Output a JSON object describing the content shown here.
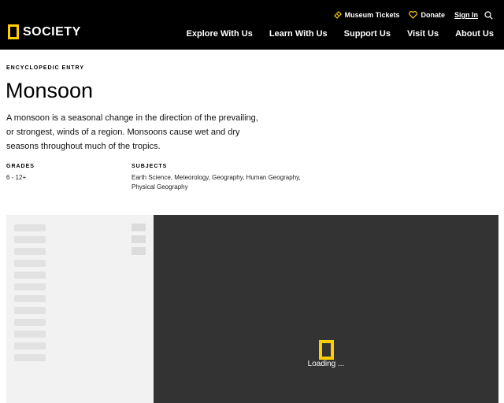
{
  "header": {
    "logo_text": "SOCIETY",
    "utility": {
      "museum_tickets": "Museum Tickets",
      "donate": "Donate",
      "sign_in": "Sign In"
    },
    "nav": [
      "Explore With Us",
      "Learn With Us",
      "Support Us",
      "Visit Us",
      "About Us"
    ]
  },
  "article": {
    "eyebrow": "ENCYCLOPEDIC ENTRY",
    "title": "Monsoon",
    "description": "A monsoon is a seasonal change in the direction of the prevailing, or strongest, winds of a region. Monsoons cause wet and dry seasons throughout much of the tropics.",
    "grades_label": "GRADES",
    "grades_value": "6 - 12+",
    "subjects_label": "SUBJECTS",
    "subjects_value": "Earth Science, Meteorology, Geography, Human Geography, Physical Geography"
  },
  "media": {
    "loading_text": "Loading ..."
  },
  "colors": {
    "brand_yellow": "#FFCE00",
    "header_bg": "#000000",
    "player_bg": "#333333"
  },
  "icons": {
    "tickets": "ticket-icon",
    "donate": "heart-icon",
    "search": "search-icon",
    "logo": "yellow-border-logo"
  }
}
